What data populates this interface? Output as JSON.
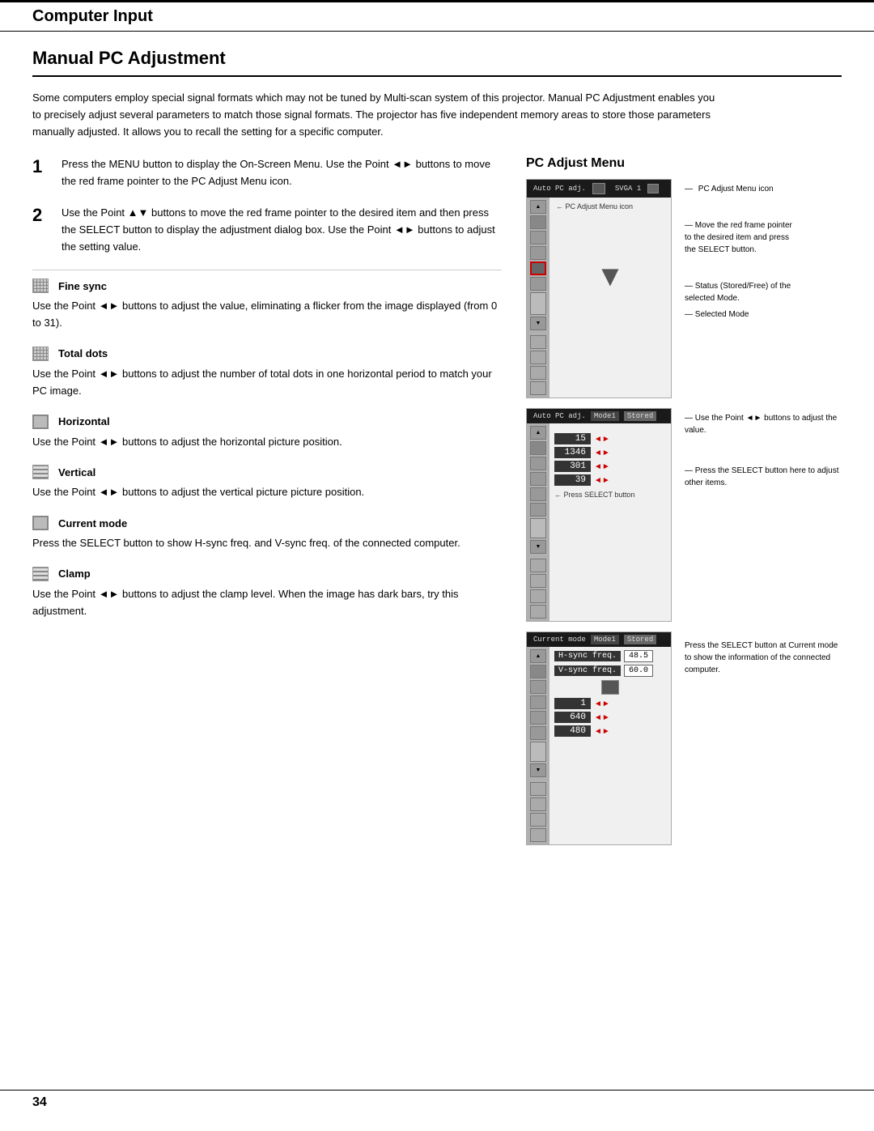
{
  "header": {
    "title": "Computer Input"
  },
  "page": {
    "title": "Manual PC Adjustment",
    "intro": "Some computers employ special signal formats which may not be tuned by Multi-scan system of this projector. Manual PC Adjustment enables you to precisely adjust several parameters to match those signal formats. The projector has five independent memory areas to store those parameters manually adjusted. It allows you to recall the setting for a specific computer.",
    "page_number": "34"
  },
  "steps": [
    {
      "number": "1",
      "text": "Press the MENU button to display the On-Screen Menu. Use the Point ◄► buttons to move the red frame pointer to the PC Adjust Menu icon."
    },
    {
      "number": "2",
      "text": "Use the Point ▲▼ buttons to move the red frame pointer to the desired item and then press the SELECT button to display the adjustment dialog box. Use the Point ◄► buttons to adjust the setting value."
    }
  ],
  "items": [
    {
      "id": "fine-sync",
      "label": "Fine sync",
      "desc": "Use the Point ◄► buttons to adjust the value, eliminating a flicker from the image displayed (from 0 to 31).",
      "icon_type": "grid"
    },
    {
      "id": "total-dots",
      "label": "Total dots",
      "desc": "Use the Point ◄► buttons to adjust the number of total dots in one horizontal period to match your PC image.",
      "icon_type": "grid"
    },
    {
      "id": "horizontal",
      "label": "Horizontal",
      "desc": "Use the Point ◄► buttons to adjust the horizontal picture position.",
      "icon_type": "monitor"
    },
    {
      "id": "vertical",
      "label": "Vertical",
      "desc": "Use the Point ◄► buttons to adjust the vertical picture position.",
      "icon_type": "lines"
    },
    {
      "id": "current-mode",
      "label": "Current mode",
      "desc": "Press the SELECT button to show H-sync freq. and V-sync freq. of the connected computer.",
      "icon_type": "monitor"
    },
    {
      "id": "clamp",
      "label": "Clamp",
      "desc": "Use the Point ◄► buttons to adjust the clamp level. When the image has dark bars, try this adjustment.",
      "icon_type": "lines"
    }
  ],
  "right_panel": {
    "title": "PC Adjust Menu",
    "diagram1": {
      "top_bar": {
        "label": "Auto PC adj.",
        "mode": "SVGA 1"
      },
      "menu_icon_label": "PC Adjust Menu icon",
      "annotation1": "Move the red frame pointer to the desired item and press the SELECT button."
    },
    "diagram1_lower": {
      "status_label": "Status (Stored/Free) of the selected Mode.",
      "selected_mode_label": "Selected Mode"
    },
    "diagram2": {
      "top_bar_label": "Auto PC adj.",
      "mode": "Mode1",
      "stored": "Stored",
      "annotation": "Use the Point ◄► buttons to adjust the value.",
      "values": [
        "15",
        "1346",
        "301",
        "39"
      ],
      "arrow_annotation": "Press the SELECT button here to adjust other items."
    },
    "diagram3": {
      "top_bar_label": "Current mode",
      "mode": "Mode1",
      "stored": "Stored",
      "h_sync_label": "H-sync freq.",
      "h_sync_val": "48.5",
      "v_sync_label": "V-sync freq.",
      "v_sync_val": "60.0",
      "values": [
        "1",
        "640",
        "480"
      ],
      "annotation": "Press the SELECT button at Current mode to show the information of the connected computer."
    }
  }
}
